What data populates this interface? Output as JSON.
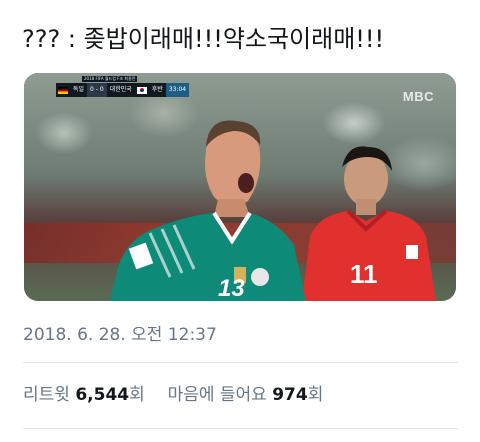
{
  "tweet": {
    "text": "??? : 좆밥이래매!!!약소국이래매!!!"
  },
  "media": {
    "broadcaster_logo": "MBC",
    "scoreboard": {
      "competition": "2018 FIFA 월드컵 F조 최종전",
      "team_left": "독일",
      "score": "0 - 0",
      "team_right": "대한민국",
      "half": "후반",
      "clock": "33:04"
    },
    "player_left_number": "13",
    "player_right_number": "11"
  },
  "meta": {
    "timestamp": "2018. 6. 28. 오전 12:37"
  },
  "stats": {
    "retweets_label": "리트윗",
    "retweets_count": "6,544",
    "retweets_unit": "회",
    "likes_label": "마음에 들어요",
    "likes_count": "974",
    "likes_unit": "회"
  },
  "colors": {
    "text_primary": "#14171a",
    "text_secondary": "#657786",
    "divider": "#e1e8ed"
  }
}
